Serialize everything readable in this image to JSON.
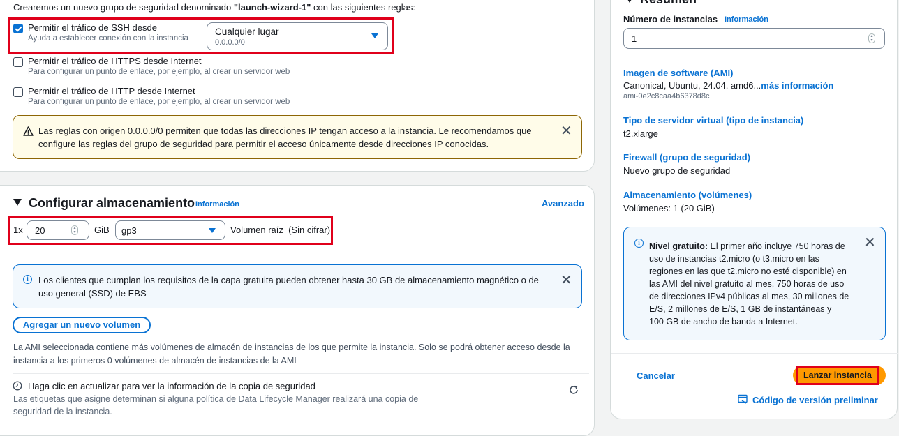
{
  "security": {
    "intro_prefix": "Crearemos un nuevo grupo de seguridad denominado ",
    "group_name": "\"launch-wizard-1\"",
    "intro_suffix": " con las siguientes reglas:",
    "ssh_label": "Permitir el tráfico de SSH desde",
    "ssh_help": "Ayuda a establecer conexión con la instancia",
    "ssh_source_value": "Cualquier lugar",
    "ssh_source_sub": "0.0.0.0/0",
    "https_label": "Permitir el tráfico de HTTPS desde Internet",
    "https_help": "Para configurar un punto de enlace, por ejemplo, al crear un servidor web",
    "http_label": "Permitir el tráfico de HTTP desde Internet",
    "http_help": "Para configurar un punto de enlace, por ejemplo, al crear un servidor web",
    "warning_line1": "Las reglas con origen 0.0.0.0/0 permiten que todas las direcciones IP tengan acceso a la instancia. Le recomendamos que",
    "warning_line2": "configure las reglas del grupo de seguridad para permitir el acceso únicamente desde direcciones IP conocidas."
  },
  "storage": {
    "title": "Configurar almacenamiento",
    "info_link": "Información",
    "advanced_link": "Avanzado",
    "multiplier": "1x",
    "size_value": "20",
    "unit": "GiB",
    "volume_type": "gp3",
    "volume_desc": "Volumen raíz  (Sin cifrar)",
    "info_line1": "Los clientes que cumplan los requisitos de la capa gratuita pueden obtener hasta 30 GB de almacenamiento magnético o de",
    "info_line2": "uso general (SSD) de EBS",
    "add_volume_button": "Agregar un nuevo volumen",
    "ami_note_line1": "La AMI seleccionada contiene más volúmenes de almacén de instancias de los que permite la instancia. Solo se podrá obtener acceso desde la",
    "ami_note_line2": "instancia a los primeros 0 volúmenes de almacén de instancias de la AMI",
    "backup_title": "Haga clic en actualizar para ver la información de la copia de seguridad",
    "backup_line1": "Las etiquetas que asigne determinan si alguna política de Data Lifecycle Manager realizará una copia de",
    "backup_line2": "seguridad de la instancia."
  },
  "summary": {
    "heading": "Resumen",
    "instances_label": "Número de instancias",
    "instances_info": "Información",
    "instances_value": "1",
    "ami_title": "Imagen de software (AMI)",
    "ami_value": "Canonical, Ubuntu, 24.04, amd6...",
    "ami_more": "más información",
    "ami_id": "ami-0e2c8caa4b6378d8c",
    "type_title": "Tipo de servidor virtual (tipo de instancia)",
    "type_value": "t2.xlarge",
    "firewall_title": "Firewall (grupo de seguridad)",
    "firewall_value": "Nuevo grupo de seguridad",
    "storage_title": "Almacenamiento (volúmenes)",
    "storage_value": "Volúmenes: 1 (20 GiB)",
    "free_tier_bold": "Nivel gratuito:",
    "free_tier_lines": [
      "El primer año incluye 750 horas de",
      "uso de instancias t2.micro (o t3.micro en las",
      "regiones en las que t2.micro no esté disponible) en",
      "las AMI del nivel gratuito al mes, 750 horas de uso",
      "de direcciones IPv4 públicas al mes, 30 millones de",
      "E/S, 2 millones de E/S, 1 GB de instantáneas y",
      "100 GB de ancho de banda a Internet."
    ],
    "cancel_button": "Cancelar",
    "launch_button": "Lanzar instancia",
    "preview_code_link": "Código de versión preliminar"
  }
}
